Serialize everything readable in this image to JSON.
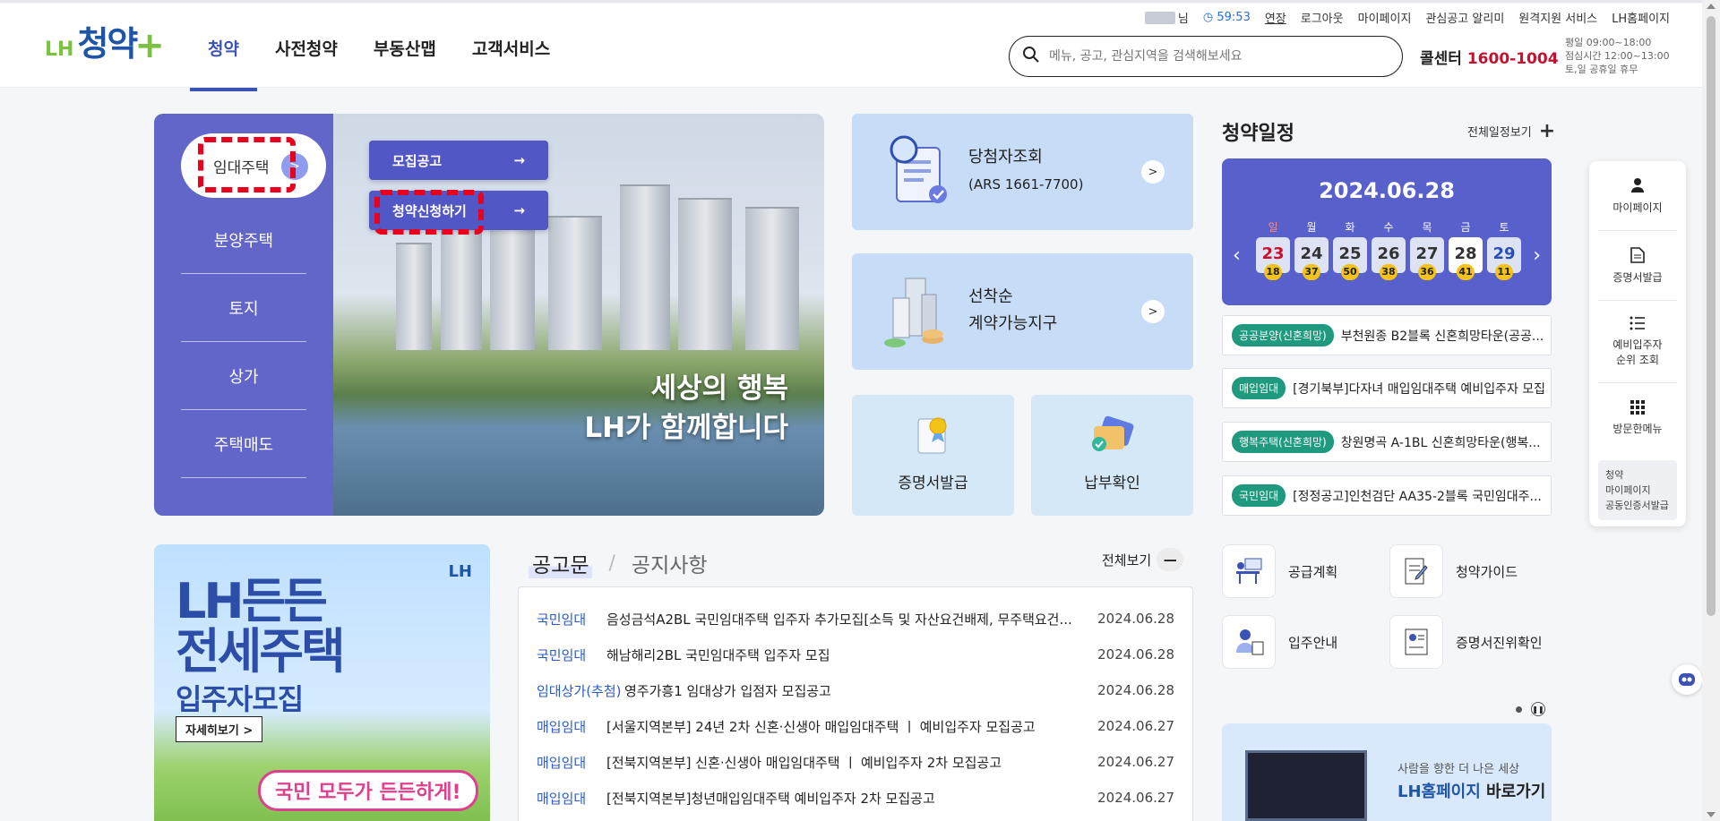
{
  "header": {
    "logo_prefix": "LH",
    "logo_name": "청약",
    "logo_plus": "+",
    "nav": [
      "청약",
      "사전청약",
      "부동산맵",
      "고객서비스"
    ],
    "util": {
      "user_suffix": "님",
      "timer": "59:53",
      "extend": "연장",
      "links": [
        "로그아웃",
        "마이페이지",
        "관심공고 알리미",
        "원격지원 서비스",
        "LH홈페이지"
      ]
    },
    "search_placeholder": "메뉴, 공고, 관심지역을 검색해보세요",
    "callcenter_label": "콜센터",
    "callcenter_number": "1600-1004",
    "hours": [
      "평일 09:00~18:00",
      "점심시간 12:00~13:00",
      "토,일 공휴일 휴무"
    ]
  },
  "hero": {
    "active_category": "임대주택",
    "categories": [
      "분양주택",
      "토지",
      "상가",
      "주택매도"
    ],
    "sub_buttons": [
      "모집공고",
      "청약신청하기"
    ],
    "tagline_1": "세상의 행복",
    "tagline_2": "LH가 함께합니다"
  },
  "cards": {
    "winner_title": "당첨자조회",
    "winner_sub": "(ARS 1661-7700)",
    "firstcome_title_1": "선착순",
    "firstcome_title_2": "계약가능지구",
    "certificate": "증명서발급",
    "payment": "납부확인"
  },
  "schedule": {
    "title": "청약일정",
    "view_all": "전체일정보기",
    "date": "2024.06.28",
    "days": [
      {
        "dow": "일",
        "day": "23",
        "count": "18"
      },
      {
        "dow": "월",
        "day": "24",
        "count": "37"
      },
      {
        "dow": "화",
        "day": "25",
        "count": "50"
      },
      {
        "dow": "수",
        "day": "26",
        "count": "38"
      },
      {
        "dow": "목",
        "day": "27",
        "count": "36"
      },
      {
        "dow": "금",
        "day": "28",
        "count": "41"
      },
      {
        "dow": "토",
        "day": "29",
        "count": "11"
      }
    ],
    "items": [
      {
        "tag": "공공분양(신혼희망)",
        "text": "부천원종 B2블록 신혼희망타운(공공..."
      },
      {
        "tag": "매입임대",
        "text": "[경기북부]다자녀 매입임대주택 예비입주자 모집"
      },
      {
        "tag": "행복주택(신혼희망)",
        "text": "창원명곡 A-1BL 신혼희망타운(행복..."
      },
      {
        "tag": "국민임대",
        "text": "[정정공고]인천검단 AA35-2블록 국민임대주..."
      }
    ]
  },
  "quick_menu": {
    "items": [
      "마이페이지",
      "증명서발급",
      "예비입주자\n순위 조회",
      "방문한메뉴"
    ],
    "visited": [
      "청약",
      "마이페이지",
      "공동인증서발급"
    ]
  },
  "banner": {
    "line1": "LH든든",
    "line2": "전세주택",
    "line3": "입주자모집",
    "more": "자세히보기 >",
    "slogan": "국민 모두가 든든하게!",
    "brand": "LH"
  },
  "notices": {
    "tab_active": "공고문",
    "tab_inactive": "공지사항",
    "separator": "/",
    "view_all": "전체보기",
    "rows": [
      {
        "cat": "국민임대",
        "title": "음성금석A2BL 국민임대주택 입주자 추가모집[소득 및 자산요건배제, 무주택요건...",
        "date": "2024.06.28"
      },
      {
        "cat": "국민임대",
        "title": "해남해리2BL 국민임대주택 입주자 모집",
        "date": "2024.06.28"
      },
      {
        "cat": "임대상가(추첨)",
        "title": "영주가흥1 임대상가 입점자 모집공고",
        "date": "2024.06.28"
      },
      {
        "cat": "매입임대",
        "title": "[서울지역본부] 24년 2차 신혼·신생아 매입임대주택 ㅣ 예비입주자 모집공고",
        "date": "2024.06.27"
      },
      {
        "cat": "매입임대",
        "title": "[전북지역본부] 신혼·신생아 매입임대주택 ㅣ 예비입주자 2차 모집공고",
        "date": "2024.06.27"
      },
      {
        "cat": "매입임대",
        "title": "[전북지역본부]청년매입임대주택 예비입주자 2차 모집공고",
        "date": "2024.06.27"
      }
    ]
  },
  "links": {
    "supply_plan": "공급계획",
    "guide": "청약가이드",
    "moving_in": "입주안내",
    "cert_verify": "증명서진위확인"
  },
  "home_banner": {
    "line1": "사람을 향한 더 나은 세상",
    "line2_brand": "LH홈페이지",
    "line2_rest": " 바로가기"
  },
  "colors": {
    "brand_blue": "#1f54a6",
    "accent_purple": "#6266c9",
    "highlight_dash": "#e8001c",
    "tag_green": "#1f9a7e"
  }
}
